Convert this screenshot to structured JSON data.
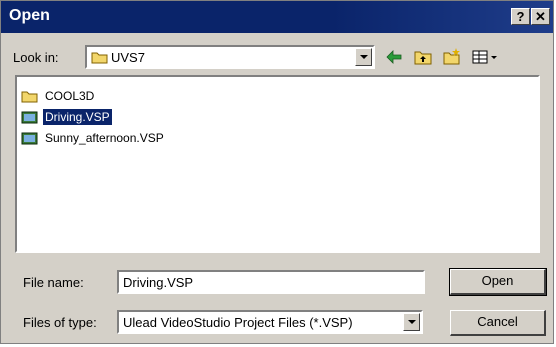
{
  "window": {
    "title": "Open",
    "help_label": "?",
    "close_label": "✕"
  },
  "lookin": {
    "label": "Look in:",
    "value": "UVS7"
  },
  "toolbar": {
    "back_icon": "back-arrow-icon",
    "up_icon": "up-folder-icon",
    "new_folder_icon": "new-folder-icon",
    "view_menu_icon": "view-menu-icon"
  },
  "files": {
    "items": [
      {
        "name": "COOL3D",
        "type": "folder"
      },
      {
        "name": "Driving.VSP",
        "type": "vsp",
        "selected": true
      },
      {
        "name": "Sunny_afternoon.VSP",
        "type": "vsp"
      }
    ]
  },
  "filename": {
    "label": "File name:",
    "value": "Driving.VSP"
  },
  "filetype": {
    "label": "Files of type:",
    "value": "Ulead VideoStudio Project Files (*.VSP)"
  },
  "buttons": {
    "open_label": "Open",
    "cancel_label": "Cancel"
  },
  "colors": {
    "titlebar": "#0a246a",
    "face": "#d4d0c8",
    "selection": "#0a246a"
  }
}
